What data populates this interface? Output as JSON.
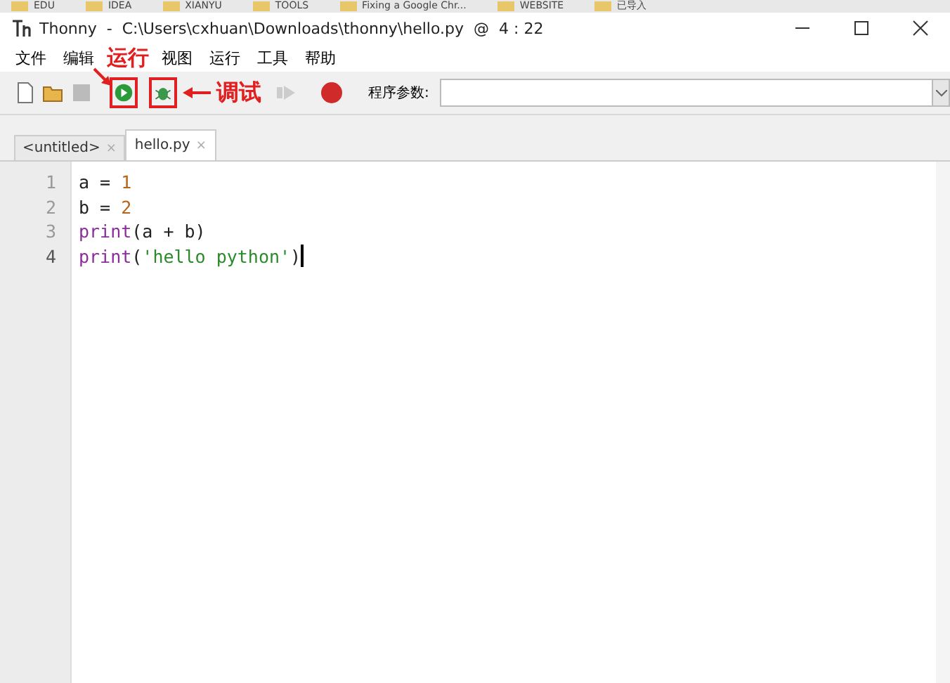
{
  "bookmarks": [
    "EDU",
    "IDEA",
    "XIANYU",
    "TOOLS",
    "Fixing a Google Chr...",
    "WEBSITE",
    "已导入"
  ],
  "window": {
    "title": "Thonny  -  C:\\Users\\cxhuan\\Downloads\\thonny\\hello.py  @  4 : 22"
  },
  "menu": [
    "文件",
    "编辑",
    "视图",
    "运行",
    "工具",
    "帮助"
  ],
  "toolbar": {
    "args_label": "程序参数:"
  },
  "tabs": [
    {
      "label": "<untitled>",
      "close": "×",
      "selected": false
    },
    {
      "label": "hello.py",
      "close": "×",
      "selected": true
    }
  ],
  "editor": {
    "lines": [
      [
        {
          "text": "a = ",
          "kind": "plain"
        },
        {
          "text": "1",
          "kind": "number"
        }
      ],
      [
        {
          "text": "b = ",
          "kind": "plain"
        },
        {
          "text": "2",
          "kind": "number"
        }
      ],
      [
        {
          "text": "print",
          "kind": "builtin"
        },
        {
          "text": "(a + b)",
          "kind": "plain"
        }
      ],
      [
        {
          "text": "print",
          "kind": "builtin"
        },
        {
          "text": "(",
          "kind": "plain"
        },
        {
          "text": "'hello python'",
          "kind": "string"
        },
        {
          "text": ")",
          "kind": "plain"
        }
      ]
    ],
    "line_numbers": [
      "1",
      "2",
      "3",
      "4"
    ],
    "cursor_line": [
      false,
      false,
      false,
      true
    ]
  },
  "annotations": {
    "run": "运行",
    "debug": "调试"
  }
}
